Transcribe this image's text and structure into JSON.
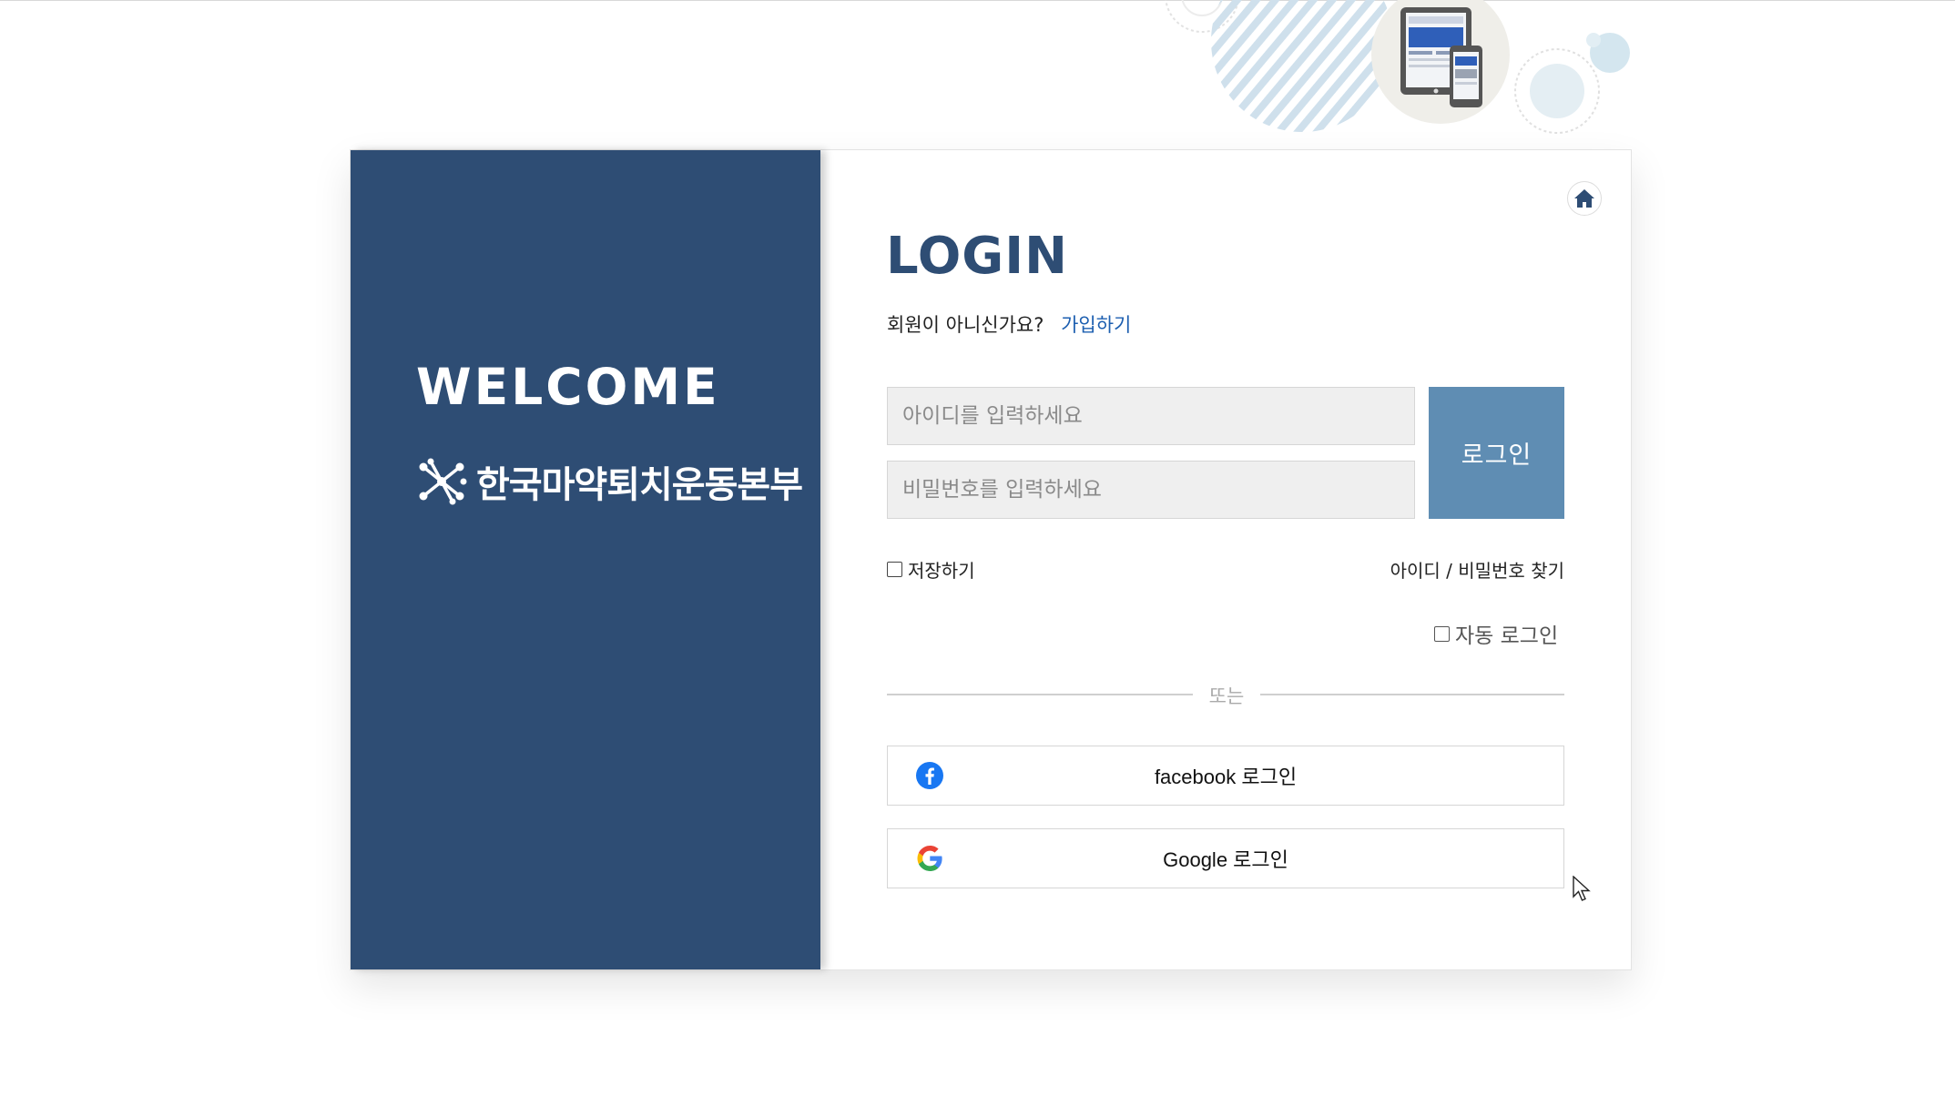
{
  "left_panel": {
    "welcome": "WELCOME",
    "org_name": "한국마약퇴치운동본부"
  },
  "login": {
    "title": "LOGIN",
    "not_member_text": "회원이 아니신가요?",
    "signup_link": "가입하기",
    "id_placeholder": "아이디를 입력하세요",
    "pw_placeholder": "비밀번호를 입력하세요",
    "login_button": "로그인",
    "save_label": "저장하기",
    "find_link": "아이디 / 비밀번호 찾기",
    "auto_login_label": "자동 로그인",
    "divider_text": "또는",
    "facebook_button": "facebook 로그인",
    "google_button": "Google 로그인"
  },
  "icons": {
    "home": "home-icon",
    "facebook": "facebook-icon",
    "google": "google-icon",
    "logo": "org-logo-icon"
  },
  "colors": {
    "panel": "#2e4d74",
    "title": "#2e4d74",
    "login_button": "#5f8db3",
    "signup_link": "#1d5fb0",
    "facebook": "#1877f2"
  }
}
